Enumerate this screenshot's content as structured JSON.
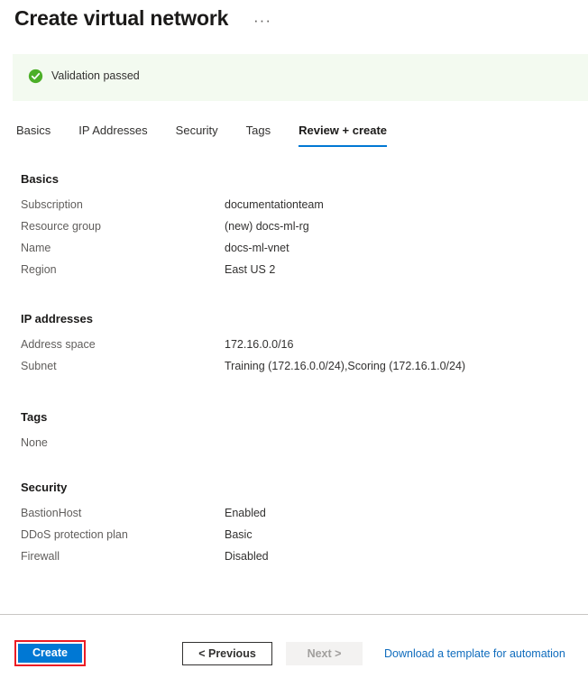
{
  "header": {
    "title": "Create virtual network",
    "more_menu": "···"
  },
  "validation": {
    "icon": "check-circle-icon",
    "text": "Validation passed",
    "background_color": "#f3faf0",
    "icon_color": "#4caf28"
  },
  "tabs": [
    {
      "label": "Basics",
      "active": false
    },
    {
      "label": "IP Addresses",
      "active": false
    },
    {
      "label": "Security",
      "active": false
    },
    {
      "label": "Tags",
      "active": false
    },
    {
      "label": "Review + create",
      "active": true
    }
  ],
  "sections": {
    "basics": {
      "title": "Basics",
      "rows": [
        {
          "label": "Subscription",
          "value": "documentationteam"
        },
        {
          "label": "Resource group",
          "value": "(new) docs-ml-rg"
        },
        {
          "label": "Name",
          "value": "docs-ml-vnet"
        },
        {
          "label": "Region",
          "value": "East US 2"
        }
      ]
    },
    "ip_addresses": {
      "title": "IP addresses",
      "rows": [
        {
          "label": "Address space",
          "value": "172.16.0.0/16"
        },
        {
          "label": "Subnet",
          "value": "Training (172.16.0.0/24),Scoring (172.16.1.0/24)"
        }
      ]
    },
    "tags": {
      "title": "Tags",
      "value": "None"
    },
    "security": {
      "title": "Security",
      "rows": [
        {
          "label": "BastionHost",
          "value": "Enabled"
        },
        {
          "label": "DDoS protection plan",
          "value": "Basic"
        },
        {
          "label": "Firewall",
          "value": "Disabled"
        }
      ]
    }
  },
  "footer": {
    "create_label": "Create",
    "previous_label": "< Previous",
    "next_label": "Next >",
    "download_link_label": "Download a template for automation",
    "accent_color": "#0078d4",
    "highlight_color": "#ec1c24",
    "link_color": "#0f6cbd"
  }
}
